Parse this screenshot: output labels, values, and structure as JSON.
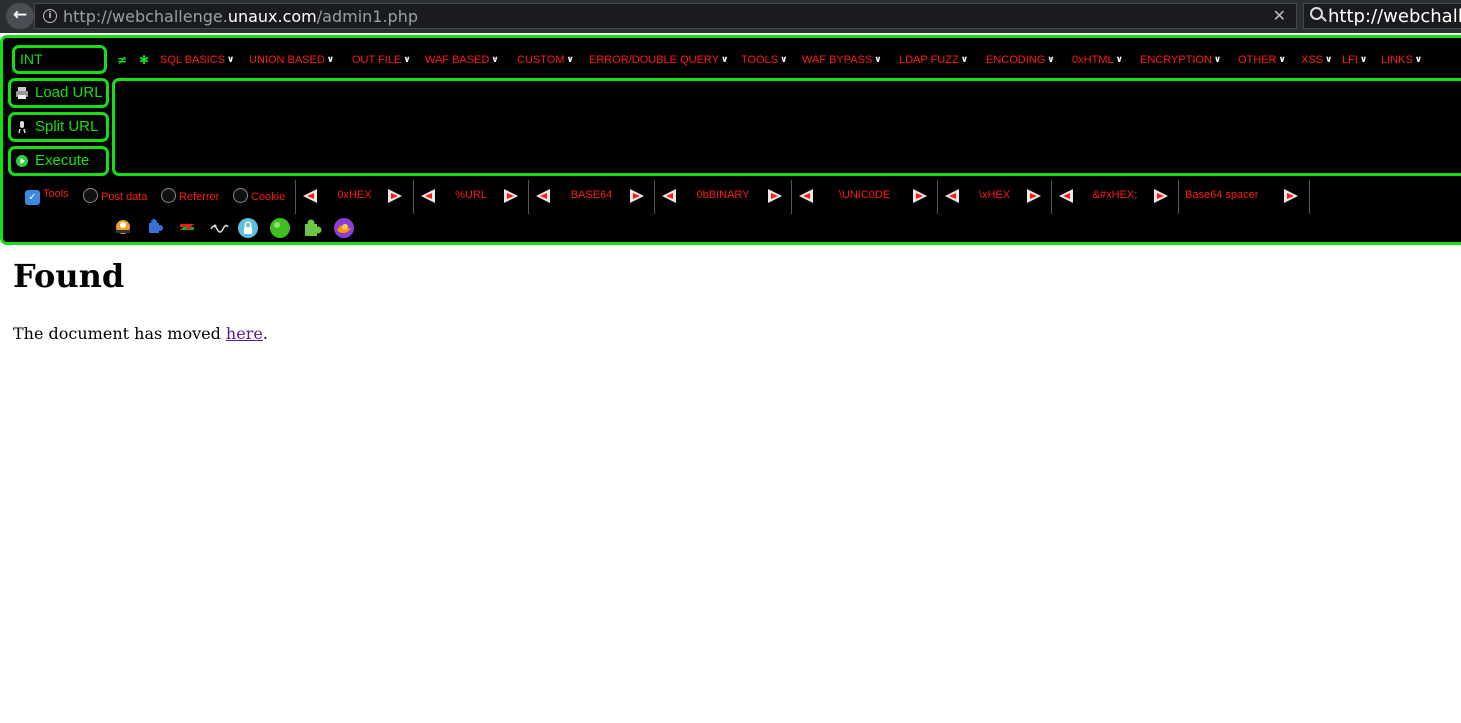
{
  "browser": {
    "url_prefix": "http://webchallenge.",
    "url_host": "unaux.com",
    "url_path": "/admin1.php",
    "search_text": "http://webchallenge"
  },
  "hackbar": {
    "int_select": "INT",
    "menus": [
      "SQL BASICS",
      "UNION BASED",
      "OUT FILE",
      "WAF BASED",
      "CUSTOM",
      "ERROR/DOUBLE QUERY",
      "TOOLS",
      "WAF BYPASS",
      "LDAP FUZZ",
      "ENCODING",
      "0xHTML",
      "ENCRYPTION",
      "OTHER",
      "XSS",
      "LFI",
      "LINKS"
    ],
    "buttons": {
      "load": "Load URL",
      "split": "Split URL",
      "execute": "Execute"
    },
    "options": {
      "tools": "Tools",
      "post": "Post data",
      "referrer": "Referrer",
      "cookie": "Cookie"
    },
    "tools_checked": true,
    "encoders": [
      "0xHEX",
      "%URL",
      "BASE64",
      "0bBINARY",
      "\\UNIC0DE",
      "\\xHEX",
      "&#xHEX;",
      "Base64 spacer"
    ],
    "icons": [
      "firebug-icon",
      "puzzle-icon",
      "refresh-icon",
      "squiggle-icon",
      "lock-icon",
      "green-dot-icon",
      "addon-puzzle-icon",
      "firefox-icon"
    ],
    "colors": {
      "accent": "#14e014",
      "menu_text": "#ff1a1a"
    }
  },
  "page": {
    "title": "Found",
    "text_before": "The document has moved ",
    "link": "here",
    "text_after": "."
  }
}
